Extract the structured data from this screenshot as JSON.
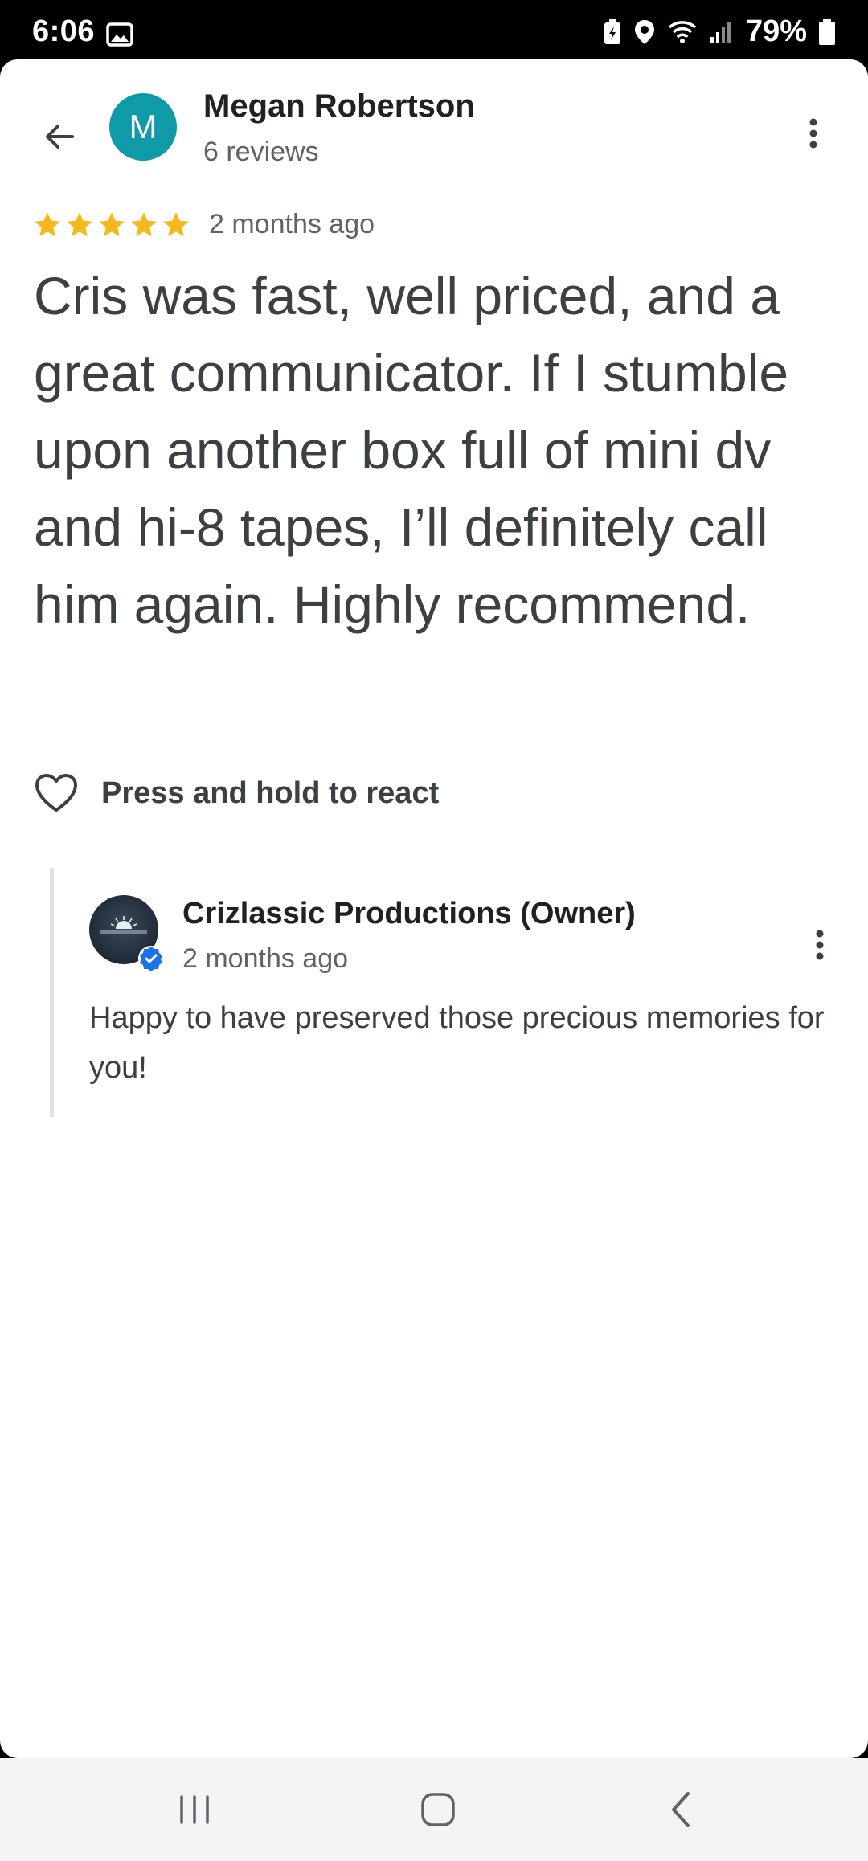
{
  "status_bar": {
    "time": "6:06",
    "battery": "79%",
    "icons": [
      "gallery-icon",
      "battery-saver-icon",
      "location-icon",
      "wifi-icon",
      "signal-icon",
      "battery-icon"
    ]
  },
  "header": {
    "back_icon": "arrow-back-icon",
    "avatar_letter": "M",
    "avatar_color": "#0f9aa8",
    "reviewer_name": "Megan Robertson",
    "review_count": "6 reviews",
    "more_icon": "more-vert-icon"
  },
  "review": {
    "stars": 5,
    "star_color": "#f6b81c",
    "time": "2 months ago",
    "text": "Cris was fast, well priced, and a great communicator. If I stumble upon another box full of mini dv and hi-8 tapes, I’ll definitely call him again. Highly recommend."
  },
  "react": {
    "icon": "heart-outline-icon",
    "label": "Press and hold to react"
  },
  "owner_reply": {
    "name": "Crizlassic Productions (Owner)",
    "time": "2 months ago",
    "text": "Happy to have preserved those precious memories for you!",
    "verified_color": "#1a73e8",
    "more_icon": "more-vert-icon"
  },
  "nav_bar": {
    "items": [
      "recent-apps-icon",
      "home-icon",
      "back-icon"
    ]
  }
}
